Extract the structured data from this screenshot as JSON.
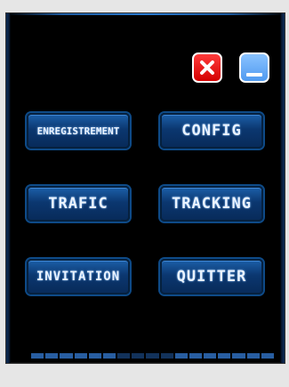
{
  "window_controls": {
    "close_icon": "close-x-icon",
    "minimize_icon": "minimize-icon"
  },
  "menu": {
    "enregistrement_label": "ENREGISTREMENT",
    "config_label": "CONFIG",
    "trafic_label": "TRAFIC",
    "tracking_label": "TRACKING",
    "invitation_label": "INVITATION",
    "quitter_label": "QUITTER"
  },
  "colors": {
    "panel_background": "#000000",
    "button_blue": "#0b3770",
    "close_red": "#e00000",
    "minimize_blue": "#5fa8f5"
  }
}
